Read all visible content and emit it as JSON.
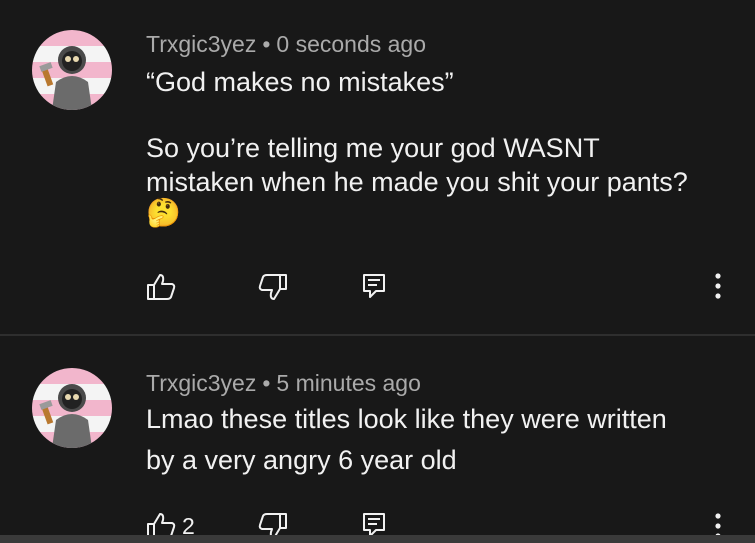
{
  "comments": [
    {
      "author": "Trxgic3yez",
      "separator": "•",
      "time": "0 seconds ago",
      "lines": [
        "“God makes no mistakes”",
        "",
        "So you’re telling me your god WASNT",
        "mistaken when he made you shit your pants?"
      ],
      "emoji": "🤔",
      "like_count": "",
      "avatar_icon": "avatar-masked-figure-icon"
    },
    {
      "author": "Trxgic3yez",
      "separator": "•",
      "time": "5 minutes ago",
      "lines": [
        "Lmao these titles look like they were written",
        "by a very angry 6 year old"
      ],
      "emoji": "",
      "like_count": "2",
      "avatar_icon": "avatar-masked-figure-icon"
    }
  ],
  "icons": [
    "thumbs-up-icon",
    "thumbs-down-icon",
    "reply-icon",
    "more-options-icon"
  ],
  "colors": {
    "background": "#181818",
    "text": "#f1f1f1",
    "meta": "#aaaaaa",
    "flag_pink": "#f2b6cc",
    "flag_white": "#f4f4f4"
  }
}
